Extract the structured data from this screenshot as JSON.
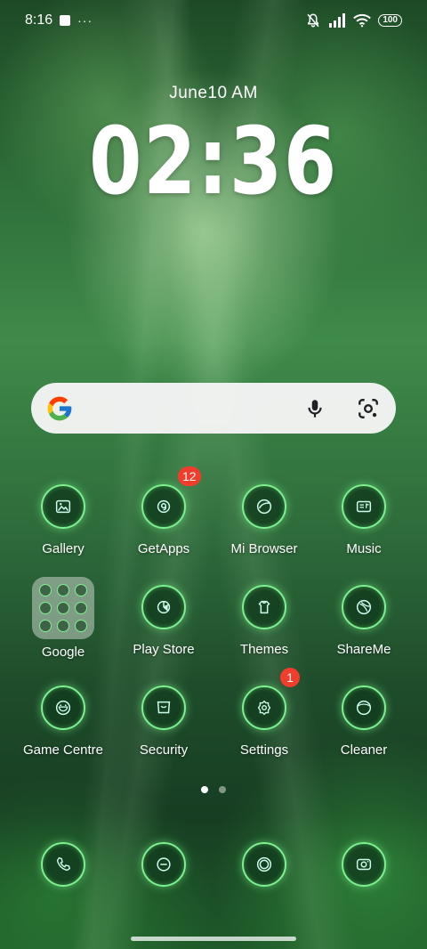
{
  "status_bar": {
    "time": "8:16",
    "dots": "···",
    "battery": "100",
    "icons": [
      "notification-square-icon",
      "mute-icon",
      "signal-icon",
      "wifi-icon",
      "battery-icon"
    ]
  },
  "lockclock": {
    "date": "June10  AM",
    "time": "02:36"
  },
  "search": {
    "icons": [
      "google-g-icon",
      "microphone-icon",
      "google-lens-icon"
    ]
  },
  "apps": [
    {
      "label": "Gallery",
      "icon": "gallery-icon"
    },
    {
      "label": "GetApps",
      "icon": "getapps-icon",
      "badge": "12"
    },
    {
      "label": "Mi Browser",
      "icon": "browser-icon"
    },
    {
      "label": "Music",
      "icon": "music-icon"
    },
    {
      "label": "Google",
      "icon": "folder-icon"
    },
    {
      "label": "Play Store",
      "icon": "play-store-icon"
    },
    {
      "label": "Themes",
      "icon": "themes-icon"
    },
    {
      "label": "ShareMe",
      "icon": "shareme-icon"
    },
    {
      "label": "Game Centre",
      "icon": "game-centre-icon"
    },
    {
      "label": "Security",
      "icon": "security-icon"
    },
    {
      "label": "Settings",
      "icon": "settings-icon",
      "badge": "1"
    },
    {
      "label": "Cleaner",
      "icon": "cleaner-icon"
    }
  ],
  "pages": {
    "count": 2,
    "current": 1
  },
  "dock": [
    {
      "icon": "phone-icon"
    },
    {
      "icon": "messages-icon"
    },
    {
      "icon": "chrome-icon"
    },
    {
      "icon": "camera-icon"
    }
  ],
  "colors": {
    "ring": "#7df08f",
    "badge": "#f23c2c"
  }
}
